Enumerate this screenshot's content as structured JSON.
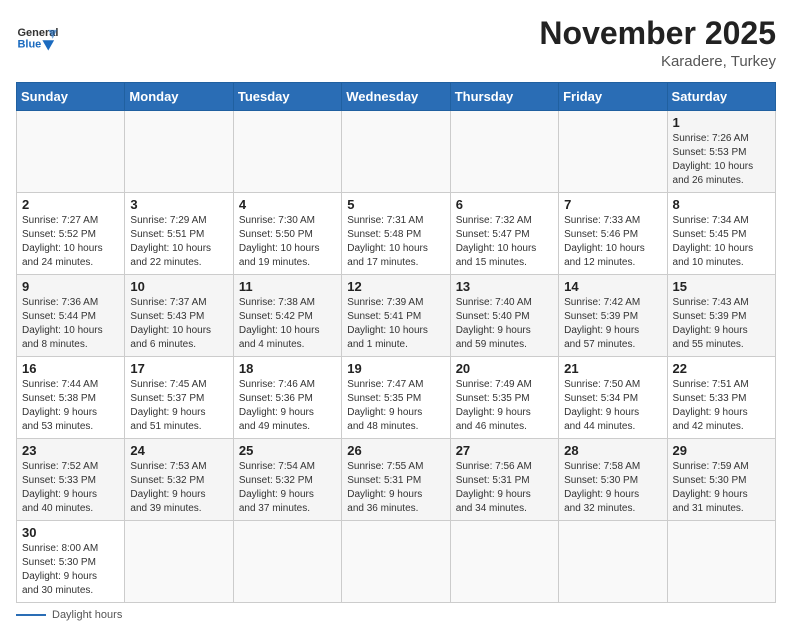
{
  "header": {
    "logo_text_general": "General",
    "logo_text_blue": "Blue",
    "month_year": "November 2025",
    "location": "Karadere, Turkey"
  },
  "weekdays": [
    "Sunday",
    "Monday",
    "Tuesday",
    "Wednesday",
    "Thursday",
    "Friday",
    "Saturday"
  ],
  "weeks": [
    [
      {
        "day": "",
        "info": ""
      },
      {
        "day": "",
        "info": ""
      },
      {
        "day": "",
        "info": ""
      },
      {
        "day": "",
        "info": ""
      },
      {
        "day": "",
        "info": ""
      },
      {
        "day": "",
        "info": ""
      },
      {
        "day": "1",
        "info": "Sunrise: 7:26 AM\nSunset: 5:53 PM\nDaylight: 10 hours\nand 26 minutes."
      }
    ],
    [
      {
        "day": "2",
        "info": "Sunrise: 7:27 AM\nSunset: 5:52 PM\nDaylight: 10 hours\nand 24 minutes."
      },
      {
        "day": "3",
        "info": "Sunrise: 7:29 AM\nSunset: 5:51 PM\nDaylight: 10 hours\nand 22 minutes."
      },
      {
        "day": "4",
        "info": "Sunrise: 7:30 AM\nSunset: 5:50 PM\nDaylight: 10 hours\nand 19 minutes."
      },
      {
        "day": "5",
        "info": "Sunrise: 7:31 AM\nSunset: 5:48 PM\nDaylight: 10 hours\nand 17 minutes."
      },
      {
        "day": "6",
        "info": "Sunrise: 7:32 AM\nSunset: 5:47 PM\nDaylight: 10 hours\nand 15 minutes."
      },
      {
        "day": "7",
        "info": "Sunrise: 7:33 AM\nSunset: 5:46 PM\nDaylight: 10 hours\nand 12 minutes."
      },
      {
        "day": "8",
        "info": "Sunrise: 7:34 AM\nSunset: 5:45 PM\nDaylight: 10 hours\nand 10 minutes."
      }
    ],
    [
      {
        "day": "9",
        "info": "Sunrise: 7:36 AM\nSunset: 5:44 PM\nDaylight: 10 hours\nand 8 minutes."
      },
      {
        "day": "10",
        "info": "Sunrise: 7:37 AM\nSunset: 5:43 PM\nDaylight: 10 hours\nand 6 minutes."
      },
      {
        "day": "11",
        "info": "Sunrise: 7:38 AM\nSunset: 5:42 PM\nDaylight: 10 hours\nand 4 minutes."
      },
      {
        "day": "12",
        "info": "Sunrise: 7:39 AM\nSunset: 5:41 PM\nDaylight: 10 hours\nand 1 minute."
      },
      {
        "day": "13",
        "info": "Sunrise: 7:40 AM\nSunset: 5:40 PM\nDaylight: 9 hours\nand 59 minutes."
      },
      {
        "day": "14",
        "info": "Sunrise: 7:42 AM\nSunset: 5:39 PM\nDaylight: 9 hours\nand 57 minutes."
      },
      {
        "day": "15",
        "info": "Sunrise: 7:43 AM\nSunset: 5:39 PM\nDaylight: 9 hours\nand 55 minutes."
      }
    ],
    [
      {
        "day": "16",
        "info": "Sunrise: 7:44 AM\nSunset: 5:38 PM\nDaylight: 9 hours\nand 53 minutes."
      },
      {
        "day": "17",
        "info": "Sunrise: 7:45 AM\nSunset: 5:37 PM\nDaylight: 9 hours\nand 51 minutes."
      },
      {
        "day": "18",
        "info": "Sunrise: 7:46 AM\nSunset: 5:36 PM\nDaylight: 9 hours\nand 49 minutes."
      },
      {
        "day": "19",
        "info": "Sunrise: 7:47 AM\nSunset: 5:35 PM\nDaylight: 9 hours\nand 48 minutes."
      },
      {
        "day": "20",
        "info": "Sunrise: 7:49 AM\nSunset: 5:35 PM\nDaylight: 9 hours\nand 46 minutes."
      },
      {
        "day": "21",
        "info": "Sunrise: 7:50 AM\nSunset: 5:34 PM\nDaylight: 9 hours\nand 44 minutes."
      },
      {
        "day": "22",
        "info": "Sunrise: 7:51 AM\nSunset: 5:33 PM\nDaylight: 9 hours\nand 42 minutes."
      }
    ],
    [
      {
        "day": "23",
        "info": "Sunrise: 7:52 AM\nSunset: 5:33 PM\nDaylight: 9 hours\nand 40 minutes."
      },
      {
        "day": "24",
        "info": "Sunrise: 7:53 AM\nSunset: 5:32 PM\nDaylight: 9 hours\nand 39 minutes."
      },
      {
        "day": "25",
        "info": "Sunrise: 7:54 AM\nSunset: 5:32 PM\nDaylight: 9 hours\nand 37 minutes."
      },
      {
        "day": "26",
        "info": "Sunrise: 7:55 AM\nSunset: 5:31 PM\nDaylight: 9 hours\nand 36 minutes."
      },
      {
        "day": "27",
        "info": "Sunrise: 7:56 AM\nSunset: 5:31 PM\nDaylight: 9 hours\nand 34 minutes."
      },
      {
        "day": "28",
        "info": "Sunrise: 7:58 AM\nSunset: 5:30 PM\nDaylight: 9 hours\nand 32 minutes."
      },
      {
        "day": "29",
        "info": "Sunrise: 7:59 AM\nSunset: 5:30 PM\nDaylight: 9 hours\nand 31 minutes."
      }
    ],
    [
      {
        "day": "30",
        "info": "Sunrise: 8:00 AM\nSunset: 5:30 PM\nDaylight: 9 hours\nand 30 minutes."
      },
      {
        "day": "",
        "info": ""
      },
      {
        "day": "",
        "info": ""
      },
      {
        "day": "",
        "info": ""
      },
      {
        "day": "",
        "info": ""
      },
      {
        "day": "",
        "info": ""
      },
      {
        "day": "",
        "info": ""
      }
    ]
  ],
  "footer": {
    "daylight_label": "Daylight hours"
  }
}
